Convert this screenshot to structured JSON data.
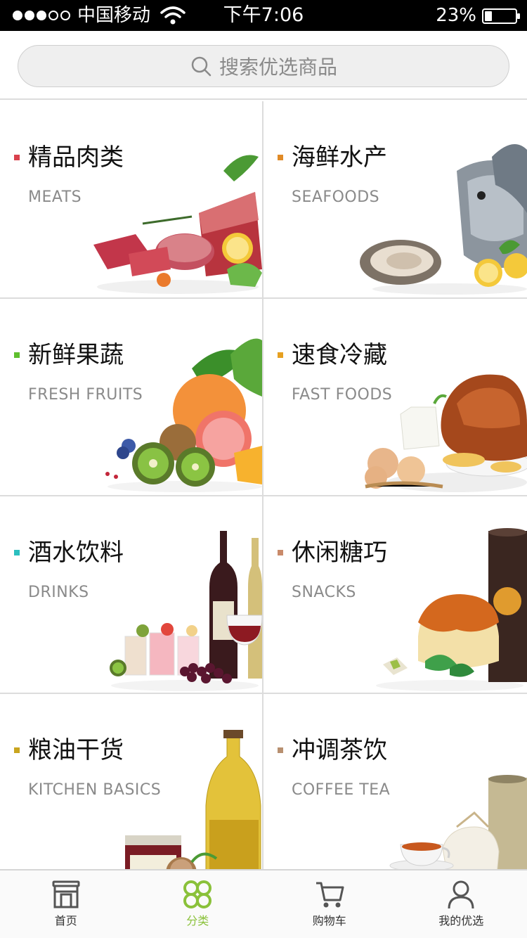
{
  "status_bar": {
    "carrier": "中国移动",
    "time": "下午7:06",
    "battery_percent_text": "23%",
    "battery_level": 0.23,
    "signal_bars_filled": 3,
    "signal_bars_total": 5
  },
  "search": {
    "placeholder": "搜索优选商品"
  },
  "categories": [
    {
      "title": "精品肉类",
      "subtitle": "MEATS",
      "marker_color": "#d9414d",
      "icon": "meat-image"
    },
    {
      "title": "海鲜水产",
      "subtitle": "SEAFOODS",
      "marker_color": "#e08a27",
      "icon": "seafood-image"
    },
    {
      "title": "新鲜果蔬",
      "subtitle": "FRESH FRUITS",
      "marker_color": "#5fbf2e",
      "icon": "fruit-image"
    },
    {
      "title": "速食冷藏",
      "subtitle": "FAST FOODS",
      "marker_color": "#e6a020",
      "icon": "fastfood-image"
    },
    {
      "title": "酒水饮料",
      "subtitle": "DRINKS",
      "marker_color": "#2bbfbf",
      "icon": "drinks-image"
    },
    {
      "title": "休闲糖巧",
      "subtitle": "SNACKS",
      "marker_color": "#c98a6a",
      "icon": "snacks-image"
    },
    {
      "title": "粮油干货",
      "subtitle": "KITCHEN BASICS",
      "marker_color": "#c9a51f",
      "icon": "kitchen-image"
    },
    {
      "title": "冲调茶饮",
      "subtitle": "COFFEE TEA",
      "marker_color": "#b89070",
      "icon": "tea-image"
    }
  ],
  "tabbar": {
    "active_color": "#8ac13a",
    "items": [
      {
        "label": "首页",
        "icon": "home-icon"
      },
      {
        "label": "分类",
        "icon": "category-icon",
        "active": true
      },
      {
        "label": "购物车",
        "icon": "cart-icon"
      },
      {
        "label": "我的优选",
        "icon": "user-icon"
      }
    ]
  }
}
